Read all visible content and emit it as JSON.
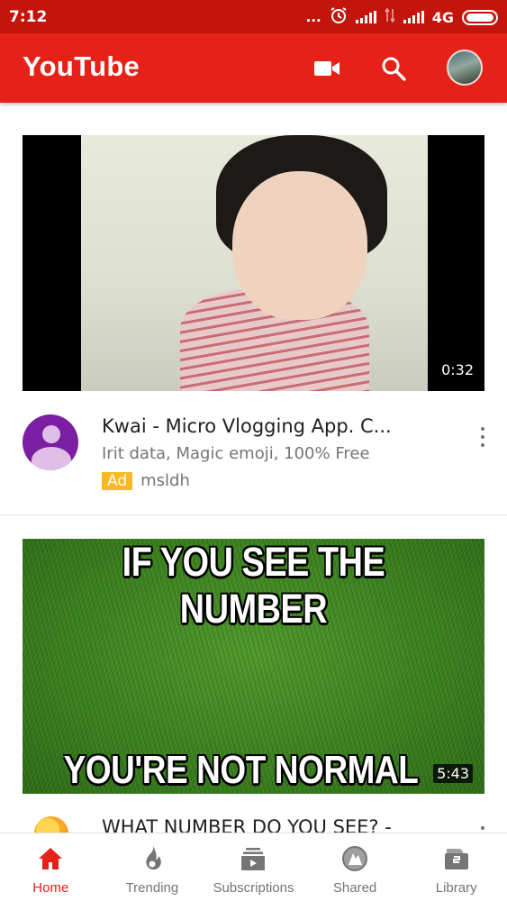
{
  "status_bar": {
    "time": "7:12",
    "dots": "...",
    "network": "4G",
    "icons": [
      "alarm-icon",
      "signal-icon",
      "data-arrows-icon",
      "signal-icon",
      "battery-icon"
    ]
  },
  "app_bar": {
    "title": "YouTube",
    "icons": [
      "video-camera-icon",
      "search-icon",
      "account-avatar"
    ]
  },
  "feed": [
    {
      "duration": "0:32",
      "title": "Kwai - Micro Vlogging App. C...",
      "description": "Irit data, Magic emoji, 100% Free",
      "badge": "Ad",
      "channel": "msldh"
    },
    {
      "thumbnail_text_top": "IF YOU SEE THE NUMBER",
      "thumbnail_text_bottom": "YOU'RE NOT NORMAL",
      "duration": "5:43",
      "title": "WHAT NUMBER DO YOU SEE? -"
    }
  ],
  "bottom_nav": [
    {
      "label": "Home",
      "icon": "home-icon",
      "active": true
    },
    {
      "label": "Trending",
      "icon": "trending-flame-icon",
      "active": false
    },
    {
      "label": "Subscriptions",
      "icon": "subscriptions-icon",
      "active": false
    },
    {
      "label": "Shared",
      "icon": "shared-icon",
      "active": false
    },
    {
      "label": "Library",
      "icon": "library-icon",
      "active": false
    }
  ],
  "colors": {
    "status_bar": "#c4150c",
    "brand_red": "#e62117",
    "ad_badge": "#f9b824",
    "channel_avatar": "#7b1fa2"
  }
}
